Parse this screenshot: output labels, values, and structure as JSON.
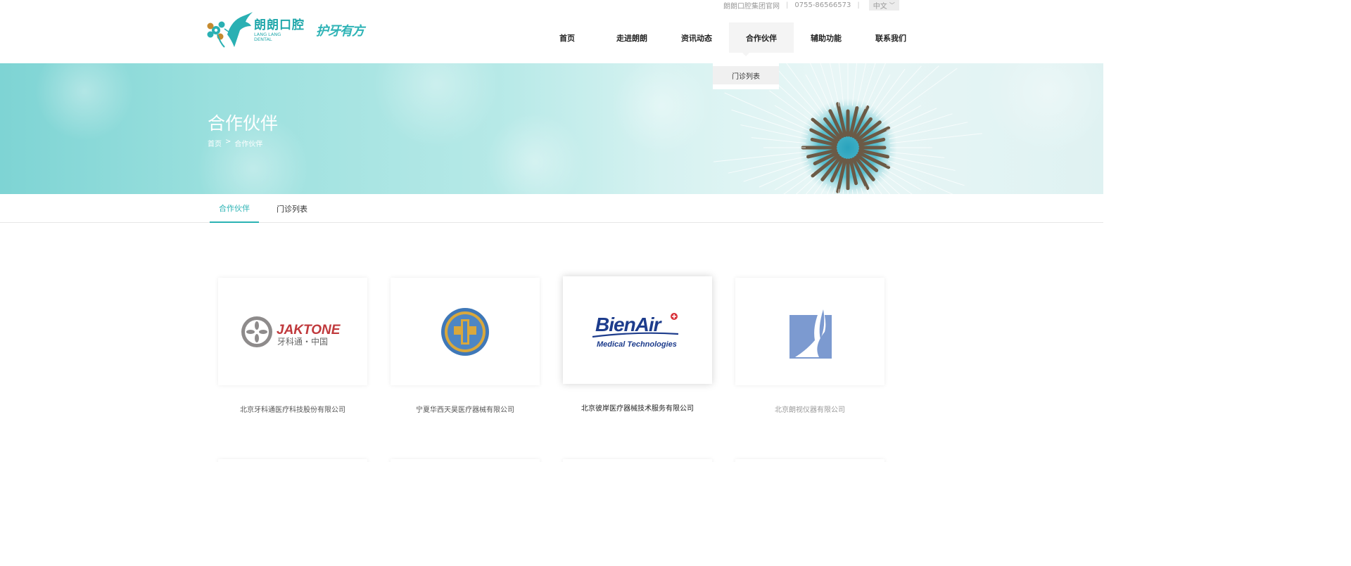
{
  "topbar": {
    "site_label": "朗朗口腔集团官网",
    "phone": "0755-86566573",
    "language": "中文"
  },
  "brand": {
    "name_cn": "朗朗口腔",
    "name_en_line1": "LANG LANG",
    "name_en_line2": "DENTAL",
    "slogan": "护牙有方",
    "primary_color": "#22a8ab"
  },
  "nav": {
    "items": [
      {
        "label": "首页"
      },
      {
        "label": "走进朗朗"
      },
      {
        "label": "资讯动态"
      },
      {
        "label": "合作伙伴"
      },
      {
        "label": "辅助功能"
      },
      {
        "label": "联系我们"
      }
    ],
    "active": "合作伙伴",
    "dropdown": [
      "门诊列表"
    ]
  },
  "banner": {
    "title": "合作伙伴",
    "breadcrumb": [
      "首页",
      ">",
      "合作伙伴"
    ]
  },
  "tabs": [
    {
      "label": "合作伙伴",
      "active": true
    },
    {
      "label": "门诊列表",
      "active": false
    }
  ],
  "partners": [
    {
      "name": "北京牙科通医疗科技股份有限公司",
      "logo_text": "JAKTONE",
      "logo_sub": "牙科通・中国"
    },
    {
      "name": "宁夏华西天昊医疗器械有限公司",
      "logo_text": "",
      "logo_sub": ""
    },
    {
      "name": "北京彼岸医疗器械技术服务有限公司",
      "logo_text": "BienAir",
      "logo_sub": "Medical Technologies"
    },
    {
      "name": "北京朗视仪器有限公司",
      "logo_text": "",
      "logo_sub": ""
    }
  ],
  "icons": {
    "logo": "hummingbird-flower-logo",
    "lang_toggle": "chevron-down-icon"
  }
}
